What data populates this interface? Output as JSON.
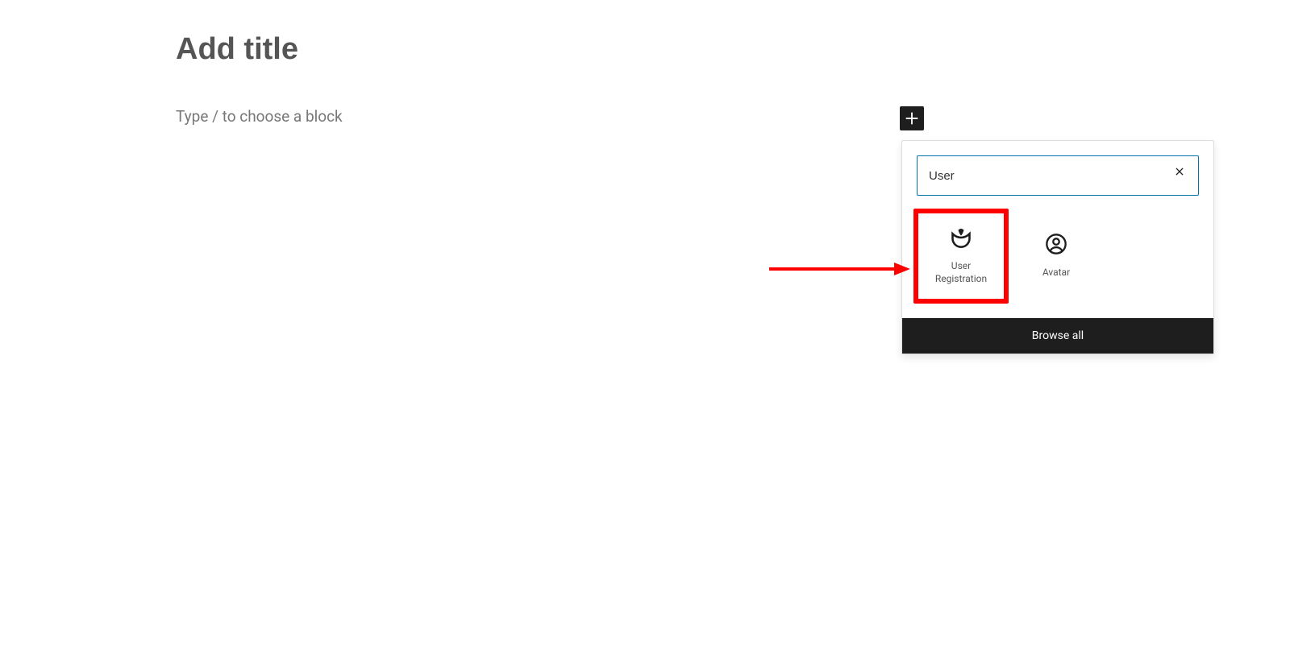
{
  "editor": {
    "title_placeholder": "Add title",
    "body_placeholder": "Type / to choose a block"
  },
  "inserter": {
    "search_value": "User",
    "blocks": [
      {
        "name": "user-registration",
        "label_line1": "User",
        "label_line2": "Registration",
        "icon": "tulip-icon"
      },
      {
        "name": "avatar",
        "label_line1": "Avatar",
        "label_line2": "",
        "icon": "avatar-icon"
      }
    ],
    "browse_all_label": "Browse all"
  }
}
